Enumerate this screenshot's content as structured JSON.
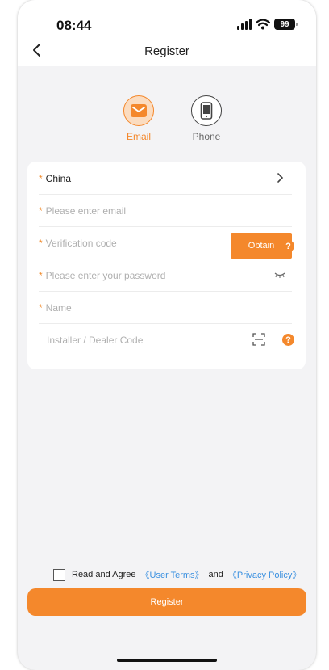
{
  "status_bar": {
    "time": "08:44",
    "battery": "99"
  },
  "nav": {
    "title": "Register"
  },
  "modes": [
    {
      "label": "Email",
      "icon": "email-icon",
      "active": true
    },
    {
      "label": "Phone",
      "icon": "phone-icon",
      "active": false
    }
  ],
  "form": {
    "country": "China",
    "email_placeholder": "Please enter email",
    "code_placeholder": "Verification code",
    "obtain_label": "Obtain",
    "password_placeholder": "Please enter your password",
    "name_placeholder": "Name",
    "dealer_placeholder": "Installer / Dealer Code"
  },
  "agreement": {
    "prefix": "Read and Agree",
    "terms": "《User Terms》",
    "and": "and",
    "privacy": "《Privacy Policy》"
  },
  "register_button": "Register",
  "colors": {
    "accent": "#f4882c",
    "link": "#3a90e0",
    "background": "#f3f3f5"
  }
}
